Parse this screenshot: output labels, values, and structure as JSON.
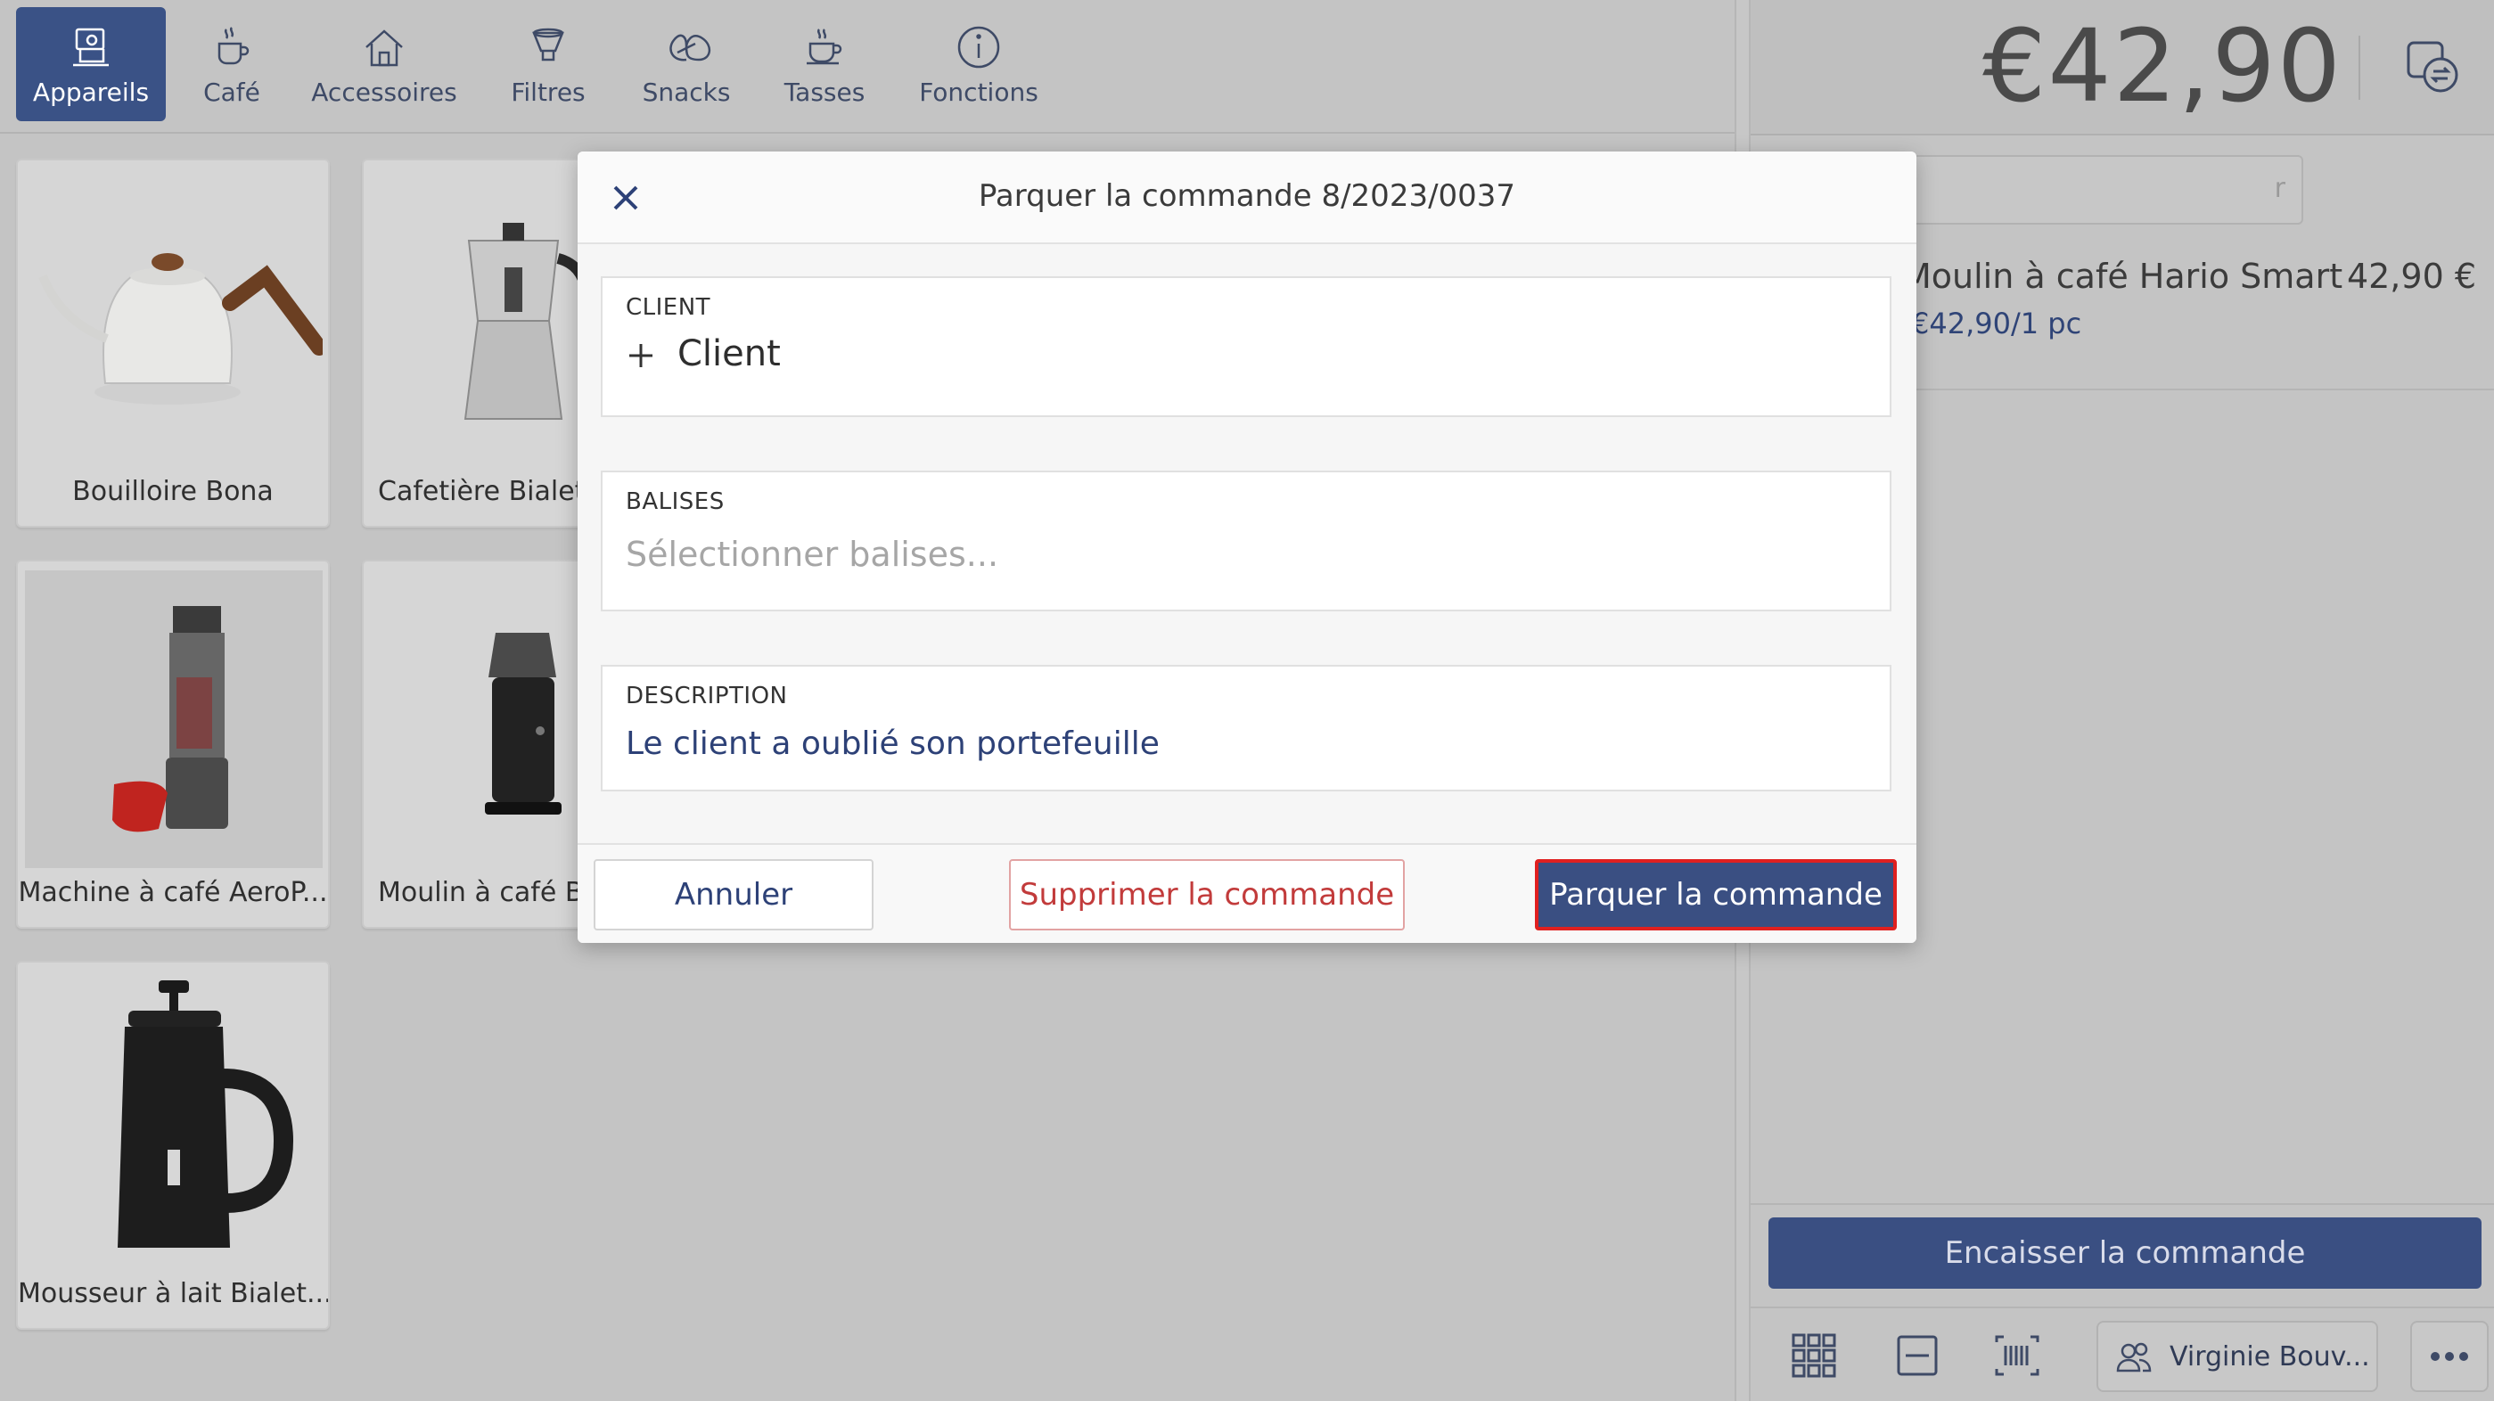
{
  "categories": [
    {
      "label": "Appareils",
      "icon": "appliance-icon",
      "active": true
    },
    {
      "label": "Café",
      "icon": "coffee-cup-icon",
      "active": false
    },
    {
      "label": "Accessoires",
      "icon": "home-icon",
      "active": false
    },
    {
      "label": "Filtres",
      "icon": "filter-icon",
      "active": false
    },
    {
      "label": "Snacks",
      "icon": "pretzel-icon",
      "active": false
    },
    {
      "label": "Tasses",
      "icon": "cup-icon",
      "active": false
    },
    {
      "label": "Fonctions",
      "icon": "info-icon",
      "active": false
    }
  ],
  "products": [
    {
      "name": "Bouilloire Bona"
    },
    {
      "name": "Cafetière Bialetti"
    },
    {
      "name": "Machine à café AeroP..."
    },
    {
      "name": "Moulin à café Bar"
    },
    {
      "name": "Mousseur à lait Bialet..."
    }
  ],
  "order": {
    "total": "€42,90",
    "search_partial": "r",
    "item_name": "Moulin à café Hario Smart",
    "item_price": "42,90 €",
    "item_unit": "€42,90/1 pc",
    "checkout_label": "Encaisser la commande",
    "user_label": "Virginie Bouv..."
  },
  "modal": {
    "title": "Parquer la commande 8/2023/0037",
    "client_label": "CLIENT",
    "client_add": "Client",
    "tags_label": "BALISES",
    "tags_placeholder": "Sélectionner balises...",
    "description_label": "DESCRIPTION",
    "description_value": "Le client a oublié son portefeuille",
    "cancel_label": "Annuler",
    "delete_label": "Supprimer la commande",
    "park_label": "Parquer la commande"
  },
  "colors": {
    "accent": "#3a4f82",
    "danger": "#c23b3b",
    "highlight": "#e02020"
  }
}
